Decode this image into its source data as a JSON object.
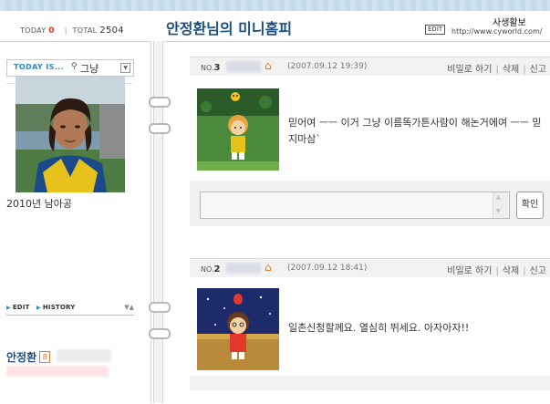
{
  "header": {
    "today_label": "TODAY",
    "today_count": "0",
    "separator": "|",
    "total_label": "TOTAL",
    "total_count": "2504",
    "title": "안정환님의 미니홈피",
    "edit_badge": "EDIT",
    "owner_name": "사생활보",
    "owner_url": "http://www.cyworld.com/"
  },
  "sidebar": {
    "today_is_label": "TODAY IS...",
    "mood": "그냥",
    "profile_caption": "2010년 남아공",
    "edit_link": "EDIT",
    "history_link": "HISTORY",
    "user_name": "안정환",
    "gender_icon_text": "8",
    "icons": {
      "mood": "lightbulb-icon",
      "dropdown": "chevron-down-icon",
      "gender": "male-icon"
    }
  },
  "entries": [
    {
      "no_label": "NO.",
      "no": "3",
      "date": "(2007.09.12 19:39)",
      "actions": [
        "비밀로 하기",
        "삭제",
        "신고"
      ],
      "text": "믿어여 ㅡㅡ 이거 그냥 이름똑가튼사람이 해논거에여 ㅡㅡ 믿지마삼`"
    },
    {
      "no_label": "NO.",
      "no": "2",
      "date": "(2007.09.12 18:41)",
      "actions": [
        "비밀로 하기",
        "삭제",
        "신고"
      ],
      "text": "일촌신청할께요. 열심히 뛰세요. 아자아자!!"
    }
  ],
  "reply": {
    "confirm_label": "확인"
  },
  "colors": {
    "title_blue": "#1b4f7f",
    "accent_blue": "#2a8bbf",
    "today_red": "#e0301e",
    "home_orange": "#e07a2a"
  }
}
